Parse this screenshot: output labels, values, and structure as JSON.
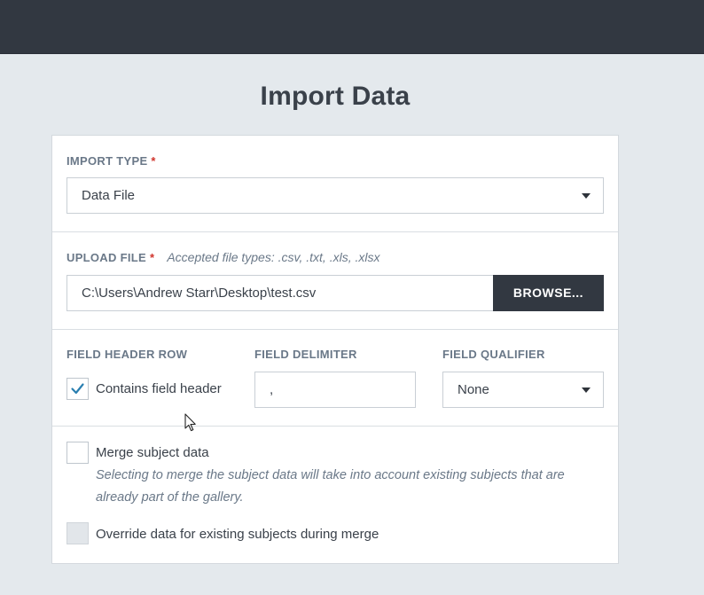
{
  "page": {
    "title": "Import Data"
  },
  "import_type": {
    "label": "IMPORT TYPE",
    "required_mark": "*",
    "selected": "Data File"
  },
  "upload_file": {
    "label": "UPLOAD FILE",
    "required_mark": "*",
    "hint": "Accepted file types: .csv, .txt, .xls, .xlsx",
    "value": "C:\\Users\\Andrew Starr\\Desktop\\test.csv",
    "browse_label": "BROWSE..."
  },
  "field_header_row": {
    "label": "FIELD HEADER ROW",
    "checkbox_label": "Contains field header",
    "checked": true
  },
  "field_delimiter": {
    "label": "FIELD DELIMITER",
    "value": ","
  },
  "field_qualifier": {
    "label": "FIELD QUALIFIER",
    "selected": "None"
  },
  "merge": {
    "label": "Merge subject data",
    "checked": false,
    "description": "Selecting to merge the subject data will take into account existing subjects that are already part of the gallery."
  },
  "override": {
    "label": "Override data for existing subjects during merge",
    "checked": false,
    "disabled": true
  },
  "colors": {
    "topbar": "#323841",
    "background": "#e4e9ed",
    "accent_check": "#2a7fb0",
    "required": "#d0342c",
    "button": "#323841"
  },
  "icons": {
    "dropdown": "caret-down-icon",
    "check": "checkmark-icon",
    "cursor": "mouse-pointer-icon"
  }
}
